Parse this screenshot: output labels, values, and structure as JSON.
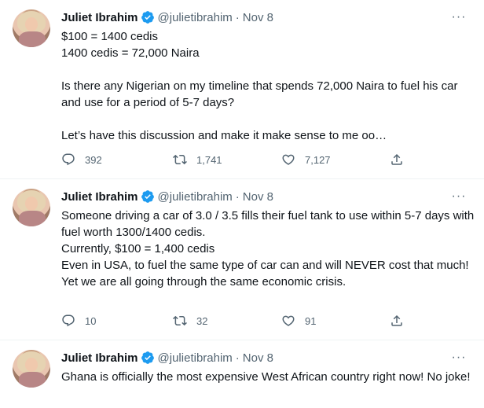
{
  "tweets": [
    {
      "name": "Juliet Ibrahim",
      "handle": "@julietibrahim",
      "dot": "·",
      "date": "Nov 8",
      "more": "···",
      "text": "$100 = 1400 cedis\n1400 cedis = 72,000 Naira\n\nIs there any Nigerian on my timeline that spends 72,000 Naira to fuel his car and use for a period of 5-7 days?\n\nLet’s have this discussion and make it make sense to me oo…",
      "replies": "392",
      "retweets": "1,741",
      "likes": "7,127"
    },
    {
      "name": "Juliet Ibrahim",
      "handle": "@julietibrahim",
      "dot": "·",
      "date": "Nov 8",
      "more": "···",
      "text": "Someone driving a car of 3.0 / 3.5 fills their fuel tank to use within 5-7 days with fuel worth 1300/1400 cedis.\nCurrently, $100 = 1,400 cedis\nEven in USA, to fuel the same type of car can and will NEVER cost that much!\nYet we are all going through the same economic crisis.",
      "replies": "10",
      "retweets": "32",
      "likes": "91"
    },
    {
      "name": "Juliet Ibrahim",
      "handle": "@julietibrahim",
      "dot": "·",
      "date": "Nov 8",
      "more": "···",
      "text": "Ghana is officially the most expensive West African country right now! No joke!"
    }
  ],
  "icons": {
    "verified": "verified-badge-icon",
    "reply": "reply-icon",
    "retweet": "retweet-icon",
    "like": "heart-icon",
    "share": "share-icon",
    "more": "more-icon"
  },
  "colors": {
    "text": "#0f1419",
    "secondary": "#536471",
    "verified": "#1d9bf0",
    "divider": "#eff3f4"
  }
}
